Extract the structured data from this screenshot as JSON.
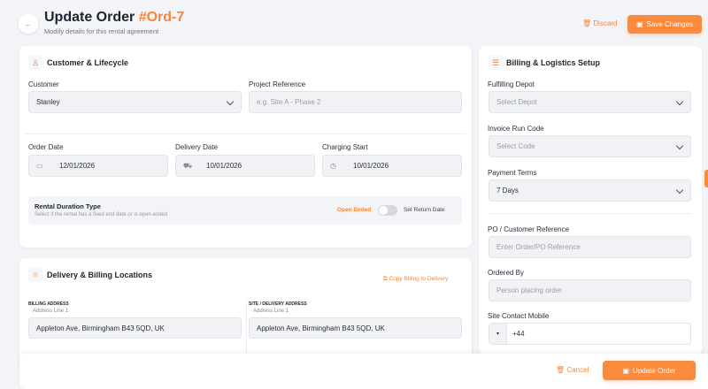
{
  "header": {
    "title": "Update Order",
    "order_id": "#Ord-7",
    "subtitle": "Modify details for this rental agreement",
    "discard": "Discard",
    "save": "Save Changes"
  },
  "customer_card": {
    "title": "Customer & Lifecycle",
    "customer_label": "Customer",
    "customer_value": "Stanley",
    "project_label": "Project Reference",
    "project_placeholder": "e.g. Site A - Phase 2",
    "order_date_label": "Order Date",
    "order_date": "12/01/2026",
    "delivery_date_label": "Delivery Date",
    "delivery_date": "10/01/2026",
    "charging_label": "Charging Start",
    "charging_date": "10/01/2026",
    "duration_title": "Rental Duration Type",
    "duration_desc": "Select if the rental has a fixed end date or is open-ended",
    "open_ended": "Open Ended",
    "set_return": "Set Return Date",
    "toggle_on": false
  },
  "locations_card": {
    "title": "Delivery & Billing Locations",
    "copy": "Copy Billing to Delivery",
    "billing_label": "BILLING ADDRESS",
    "site_label": "SITE / DELIVERY ADDRESS",
    "line1_label": "Address Line 1",
    "billing_line1": "Appleton Ave, Birmingham B43 5QD, UK",
    "site_line1": "Appleton Ave, Birmingham B43 5QD, UK"
  },
  "billing_card": {
    "title": "Billing & Logistics Setup",
    "depot_label": "Fulfilling Depot",
    "depot_placeholder": "Select Depot",
    "invoice_label": "Invoice Run Code",
    "invoice_placeholder": "Select Code",
    "terms_label": "Payment Terms",
    "terms_value": "7 Days",
    "po_label": "PO / Customer Reference",
    "po_placeholder": "Enter Order/PO Reference",
    "ordered_by_label": "Ordered By",
    "ordered_by_placeholder": "Person placing order",
    "mobile_label": "Site Contact Mobile",
    "mobile_value": "+44"
  },
  "footer": {
    "cancel": "Cancel",
    "update": "Update Order"
  },
  "colors": {
    "accent": "#fb8a3c",
    "background": "#f3f4f7"
  }
}
